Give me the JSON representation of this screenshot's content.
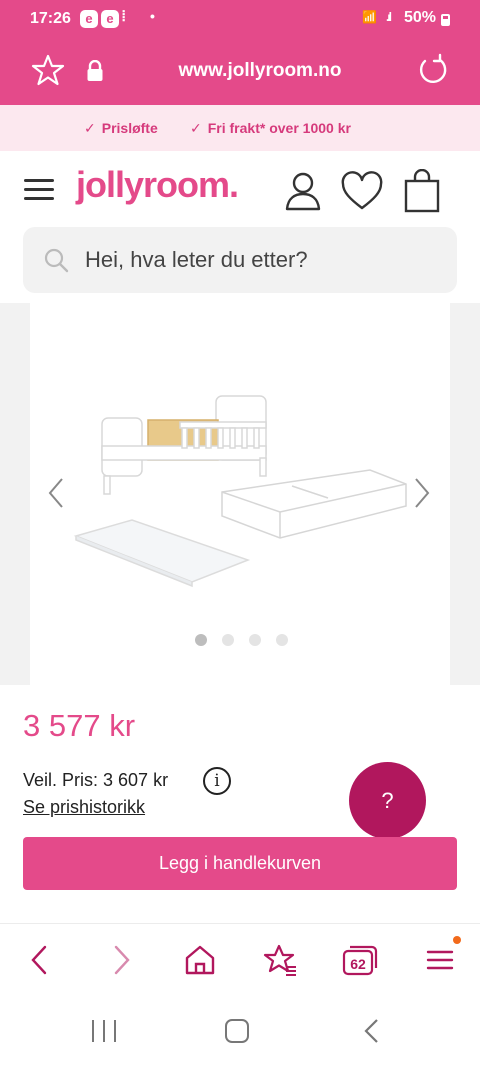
{
  "status": {
    "time": "17:26",
    "badge1": "e",
    "badge2": "e",
    "battery": "50%"
  },
  "browser": {
    "url": "www.jollyroom.no"
  },
  "promo": {
    "item1": "Prisløfte",
    "item2": "Fri frakt* over 1000 kr"
  },
  "header": {
    "logo": "jollyroom."
  },
  "search": {
    "placeholder": "Hei, hva leter du etter?"
  },
  "gallery": {
    "dots": 4,
    "active_dot": 1
  },
  "product": {
    "price": "3 577 kr",
    "recommended_price": "Veil. Pris: 3 607 kr",
    "history_link": "Se prishistorikk",
    "add_to_cart": "Legg i handlekurven",
    "help": "?"
  },
  "bottom_nav": {
    "tab_count": "62"
  },
  "colors": {
    "brand": "#e44a8a",
    "help": "#b1175d",
    "promo_bg": "#fce8ef"
  }
}
